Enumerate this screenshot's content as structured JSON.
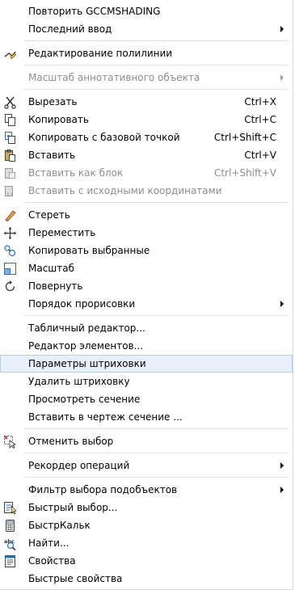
{
  "menu": {
    "items": {
      "repeat": "Повторить GCCMSHADING",
      "last_input": "Последний ввод",
      "edit_polyline": "Редактирование полилинии",
      "anno_scale": "Масштаб аннотативного объекта",
      "cut": {
        "label": "Вырезать",
        "shortcut": "Ctrl+X"
      },
      "copy": {
        "label": "Копировать",
        "shortcut": "Ctrl+C"
      },
      "copy_base": {
        "label": "Копировать с базовой точкой",
        "shortcut": "Ctrl+Shift+C"
      },
      "paste": {
        "label": "Вставить",
        "shortcut": "Ctrl+V"
      },
      "paste_block": {
        "label": "Вставить как блок",
        "shortcut": "Ctrl+Shift+V"
      },
      "paste_orig": "Вставить с исходными координатами",
      "erase": "Стереть",
      "move": "Переместить",
      "copy_sel": "Копировать выбранные",
      "scale": "Масштаб",
      "rotate": "Повернуть",
      "draw_order": "Порядок прорисовки",
      "table_editor": "Табличный редактор...",
      "element_editor": "Редактор элементов...",
      "hatch_params": "Параметры штриховки",
      "delete_hatch": "Удалить штриховку",
      "view_section": "Просмотреть сечение",
      "insert_section": "Вставить в чертеж сечение ...",
      "deselect": "Отменить выбор",
      "action_recorder": "Рекордер операций",
      "subobject_filter": "Фильтр выбора подобъектов",
      "quick_select": "Быстрый выбор...",
      "quickcalc": "БыстрКальк",
      "find": "Найти...",
      "properties": "Свойства",
      "quick_properties": "Быстрые свойства"
    }
  },
  "icons": [
    "polyline-edit-icon",
    "scissors-icon",
    "copy-icon",
    "copy-base-point-icon",
    "clipboard-paste-icon",
    "paste-block-icon",
    "paste-original-coords-icon",
    "eraser-icon",
    "move-icon",
    "copy-selection-icon",
    "scale-icon",
    "rotate-icon",
    "deselect-icon",
    "quick-select-icon",
    "calculator-icon",
    "find-icon",
    "properties-icon"
  ],
  "colors": {
    "highlight": "#e8f1fb",
    "highlight_border": "#b1d0f0",
    "disabled_text": "#8d8d8d",
    "separator": "#e2e2e2"
  }
}
